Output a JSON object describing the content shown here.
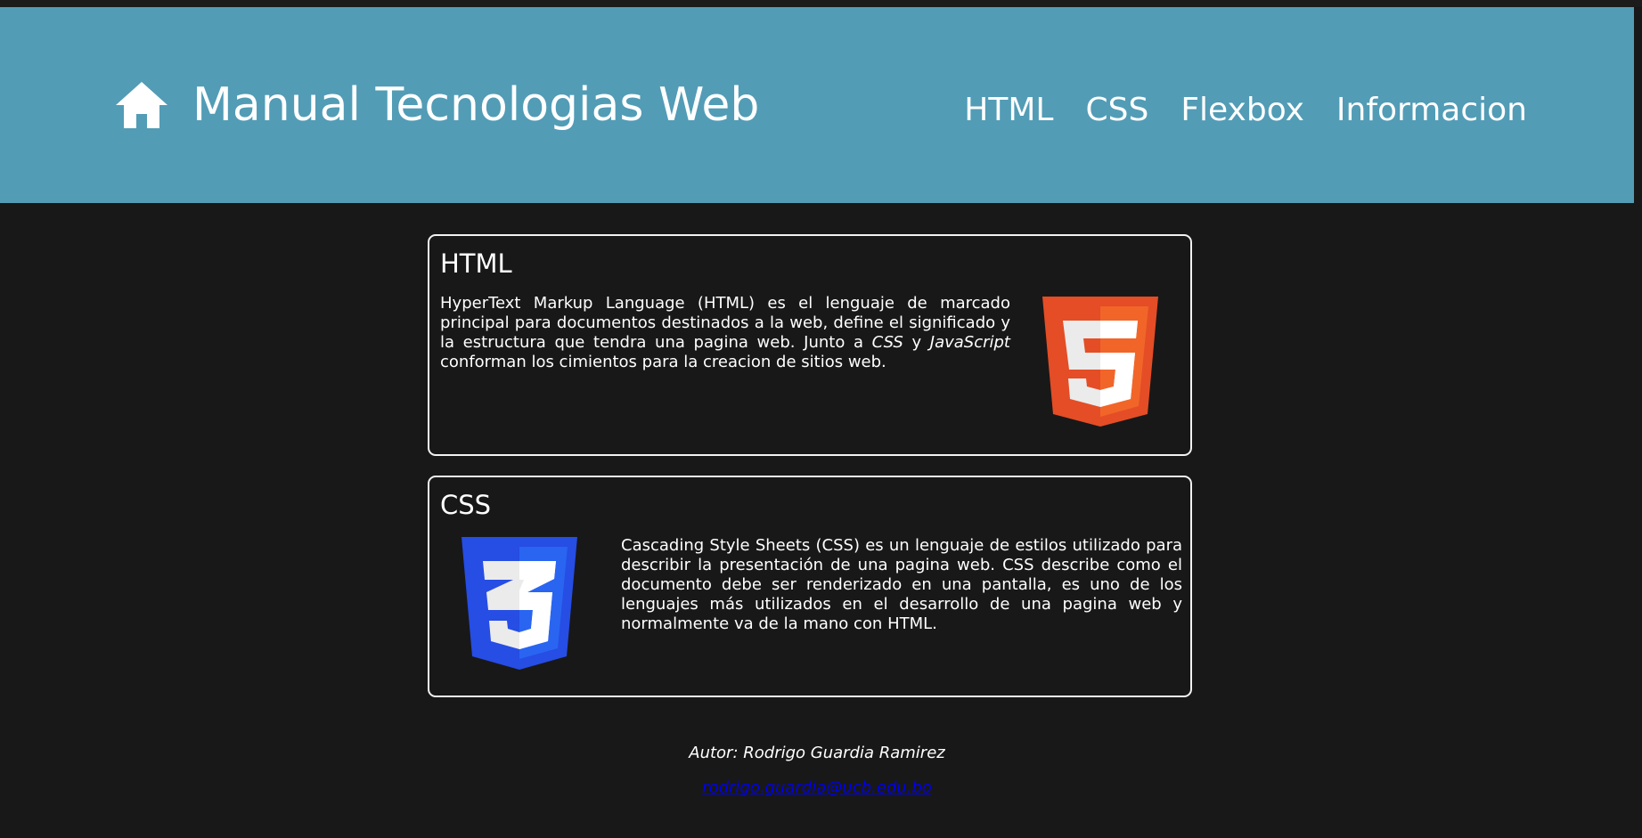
{
  "header": {
    "icon": "home-icon",
    "title": "Manual Tecnologias Web",
    "background_color": "#529cb6",
    "nav": [
      {
        "label": "HTML"
      },
      {
        "label": "CSS"
      },
      {
        "label": "Flexbox"
      },
      {
        "label": "Informacion"
      }
    ]
  },
  "cards": [
    {
      "title": "HTML",
      "text_parts": [
        "HyperText Markup Language (HTML) es el lenguaje de marcado principal para documentos destinados a la web, define el significado y la estructura que tendra una pagina web. Junto a ",
        "CSS",
        " y ",
        "JavaScript",
        " conforman los cimientos para la creacion de sitios web."
      ],
      "logo_icon": "html5-logo-icon",
      "logo_digit": "5",
      "logo_color": "#e44d26"
    },
    {
      "title": "CSS",
      "text": "Cascading Style Sheets (CSS) es un lenguaje de estilos utilizado para describir la presentación de una pagina web. CSS describe como el documento debe ser renderizado en una pantalla, es uno de los lenguajes más utilizados en el desarrollo de una pagina web y normalmente va de la mano con HTML.",
      "logo_icon": "css3-logo-icon",
      "logo_digit": "3",
      "logo_color": "#264de4"
    }
  ],
  "footer": {
    "author": "Autor: Rodrigo Guardia Ramirez",
    "email": "rodrigo.guardia@ucb.edu.bo"
  },
  "colors": {
    "background": "#181818",
    "card_border": "#f2f2f2",
    "link": "#0000ee"
  }
}
